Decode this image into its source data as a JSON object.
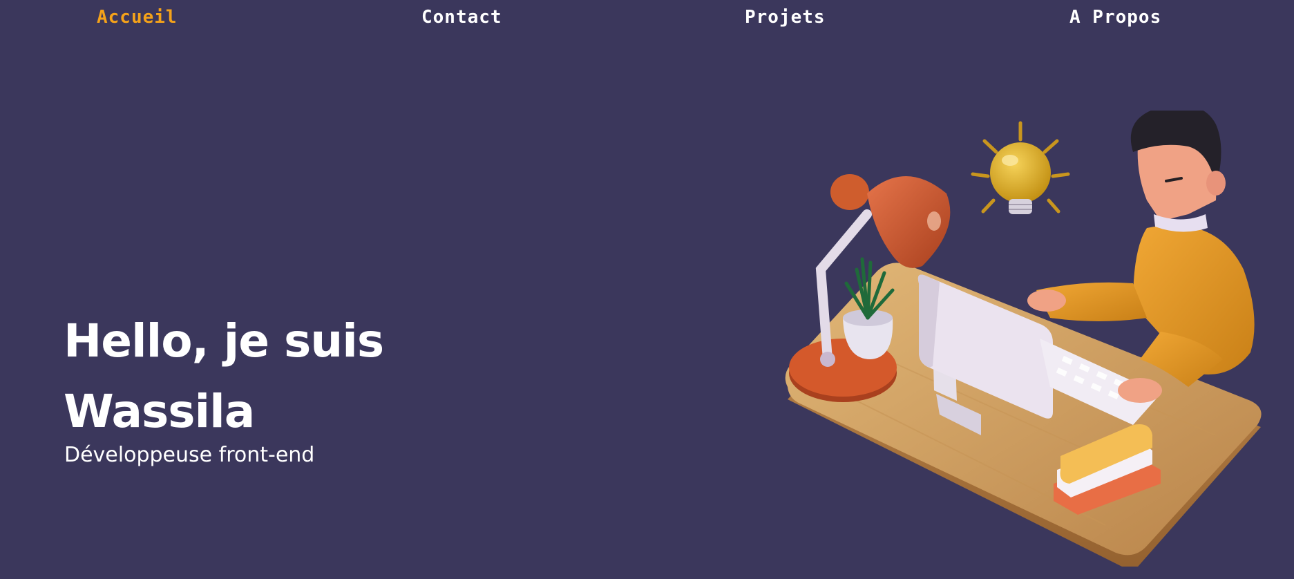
{
  "nav": {
    "items": [
      {
        "label": "Accueil",
        "active": true
      },
      {
        "label": "Contact",
        "active": false
      },
      {
        "label": "Projets",
        "active": false
      },
      {
        "label": "A Propos",
        "active": false
      }
    ]
  },
  "hero": {
    "title_line1": "Hello, je suis",
    "title_line2": "Wassila",
    "subtitle": "Développeuse front-end"
  },
  "illustration": {
    "icon": "developer-at-desk-illustration"
  },
  "colors": {
    "background": "#3b375c",
    "accent": "#f4a21a",
    "text": "#ffffff"
  }
}
